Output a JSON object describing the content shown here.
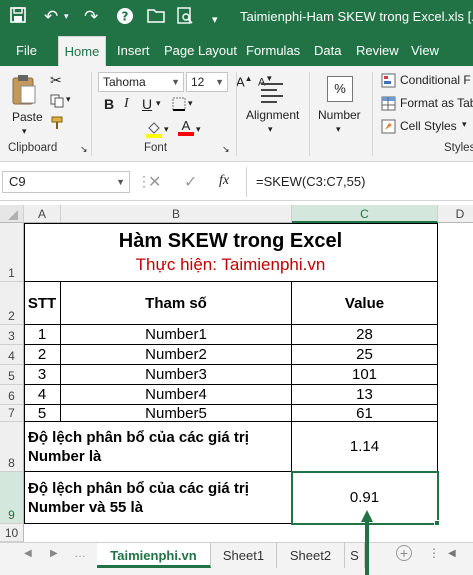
{
  "window": {
    "title": "Taimienphi-Ham SKEW trong Excel.xls  [..."
  },
  "tabs": [
    "File",
    "Home",
    "Insert",
    "Page Layout",
    "Formulas",
    "Data",
    "Review",
    "View"
  ],
  "ribbon": {
    "paste": "Paste",
    "clipboard": "Clipboard",
    "font_name": "Tahoma",
    "font_size": "12",
    "bold": "B",
    "italic": "I",
    "underline": "U",
    "font_group": "Font",
    "alignment": "Alignment",
    "number": "Number",
    "percent": "%",
    "conditional": "Conditional F",
    "format_table": "Format as Tab",
    "cell_styles": "Cell Styles",
    "styles_group": "Styles"
  },
  "formula_bar": {
    "name_box": "C9",
    "fx": "fx",
    "formula": "=SKEW(C3:C7,55)"
  },
  "columns": [
    "A",
    "B",
    "C",
    "D"
  ],
  "rows": [
    "1",
    "2",
    "3",
    "4",
    "5",
    "6",
    "7",
    "8",
    "9",
    "10"
  ],
  "sheet": {
    "title": "Hàm SKEW trong Excel",
    "subtitle": "Thực hiện: Taimienphi.vn",
    "headers": {
      "stt": "STT",
      "param": "Tham số",
      "value": "Value"
    },
    "data": [
      {
        "stt": "1",
        "param": "Number1",
        "value": "28"
      },
      {
        "stt": "2",
        "param": "Number2",
        "value": "25"
      },
      {
        "stt": "3",
        "param": "Number3",
        "value": "101"
      },
      {
        "stt": "4",
        "param": "Number4",
        "value": "13"
      },
      {
        "stt": "5",
        "param": "Number5",
        "value": "61"
      }
    ],
    "row8_label": "Độ lệch phân bổ của các giá trị Number là",
    "row8_value": "1.14",
    "row9_label": "Độ lệch phân bổ của các giá trị Number và 55 là",
    "row9_value": "0.91"
  },
  "sheet_tabs": [
    "Taimienphi.vn",
    "Sheet1",
    "Sheet2",
    "S"
  ],
  "colors": {
    "excel_green": "#217346",
    "subtitle_red": "#c00000"
  }
}
